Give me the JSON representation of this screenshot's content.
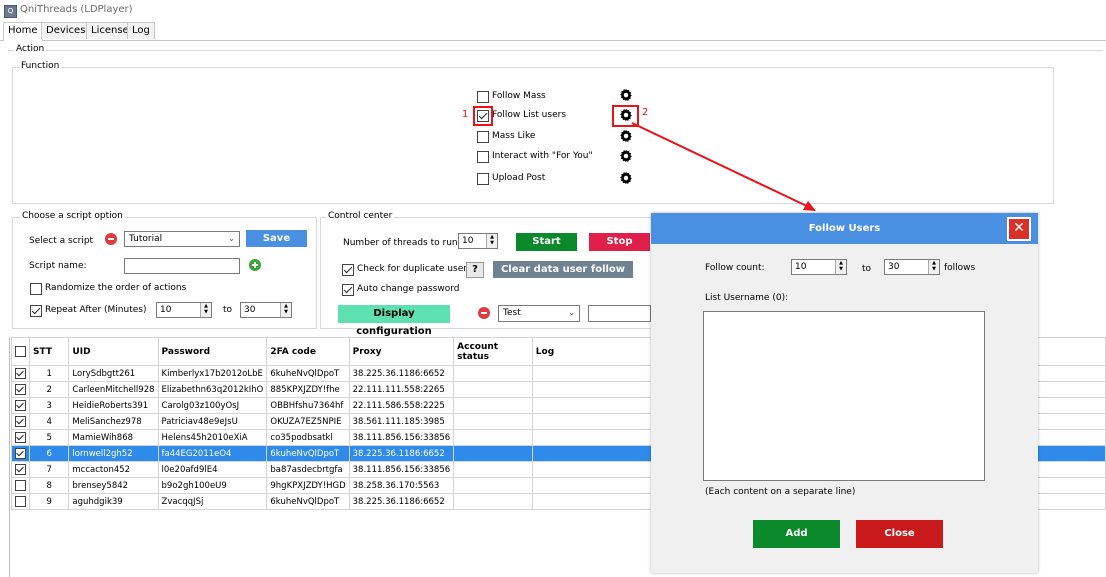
{
  "window": {
    "title": "QniThreads (LDPlayer)",
    "icon": "app-icon"
  },
  "tabs": [
    {
      "label": "Home"
    },
    {
      "label": "Devices"
    },
    {
      "label": "License"
    },
    {
      "label": "Log"
    }
  ],
  "action_group": {
    "label": "Action"
  },
  "function_group": {
    "label": "Function",
    "items": [
      {
        "label": "Follow Mass",
        "checked": false
      },
      {
        "label": "Follow List users",
        "checked": true
      },
      {
        "label": "Mass Like",
        "checked": false
      },
      {
        "label": "Interact with \"For You\"",
        "checked": false
      },
      {
        "label": "Upload Post",
        "checked": false
      }
    ],
    "annotations": {
      "one": "1",
      "two": "2"
    }
  },
  "script_group": {
    "label": "Choose a script option",
    "select_label": "Select a script",
    "select_value": "Tutorial",
    "save_label": "Save",
    "script_name_label": "Script name:",
    "script_name_value": "",
    "randomize_label": "Randomize the order of actions",
    "randomize_checked": false,
    "repeat_label": "Repeat After (Minutes)",
    "repeat_checked": true,
    "repeat_from": "10",
    "repeat_to_label": "to",
    "repeat_to": "30"
  },
  "control_center": {
    "label": "Control center",
    "threads_label": "Number of threads to run:",
    "threads_value": "10",
    "start_label": "Start",
    "stop_label": "Stop",
    "check_dup_label": "Check for duplicate users",
    "check_dup_checked": true,
    "help_label": "?",
    "clear_label": "Clear data user follow",
    "auto_change_label": "Auto change password",
    "auto_change_checked": true,
    "display_config_label": "Display configuration",
    "config_select_value": "Test",
    "config_input_value": ""
  },
  "table": {
    "headers": [
      "STT",
      "UID",
      "Password",
      "2FA code",
      "Proxy",
      "Account status",
      "Log"
    ],
    "rows": [
      {
        "checked": true,
        "stt": "1",
        "uid": "LorySdbgtt261",
        "password": "Kimberlyx17b2012oLbE",
        "twofa": "6kuheNvQlDpoT",
        "proxy": "38.225.36.1186:6652",
        "status": "",
        "log": "",
        "selected": false
      },
      {
        "checked": true,
        "stt": "2",
        "uid": "CarleenMitchell928",
        "password": "Elizabethn63q2012kIhO",
        "twofa": "885KPXJZDY!fhe",
        "proxy": "22.111.111.558:2265",
        "status": "",
        "log": "",
        "selected": false
      },
      {
        "checked": true,
        "stt": "3",
        "uid": "HeidieRoberts391",
        "password": "Carolg03z100yOsJ",
        "twofa": "OBBHfshu7364hf",
        "proxy": "22.111.586.558:2225",
        "status": "",
        "log": "",
        "selected": false
      },
      {
        "checked": true,
        "stt": "4",
        "uid": "MeliSanchez978",
        "password": "Patriciav48e9eJsU",
        "twofa": "OKUZA7EZ5NPIE",
        "proxy": "38.561.111.185:3985",
        "status": "",
        "log": "",
        "selected": false
      },
      {
        "checked": true,
        "stt": "5",
        "uid": "MamieWih868",
        "password": "Helens45h2010eXiA",
        "twofa": "co35podbsatkl",
        "proxy": "38.111.856.156:33856",
        "status": "",
        "log": "",
        "selected": false
      },
      {
        "checked": true,
        "stt": "6",
        "uid": "lornwell2gh52",
        "password": "fa44EG2011eO4",
        "twofa": "6kuheNvQlDpoT",
        "proxy": "38.225.36.1186:6652",
        "status": "",
        "log": "",
        "selected": true
      },
      {
        "checked": true,
        "stt": "7",
        "uid": "mccacton452",
        "password": "l0e20afd9lE4",
        "twofa": "ba87asdecbrtgfa",
        "proxy": "38.111.856.156:33856",
        "status": "",
        "log": "",
        "selected": false
      },
      {
        "checked": false,
        "stt": "8",
        "uid": "brensey5842",
        "password": "b9o2gh100eU9",
        "twofa": "9hgKPXJZDY!HGD",
        "proxy": "38.258.36.170:5563",
        "status": "",
        "log": "",
        "selected": false
      },
      {
        "checked": false,
        "stt": "9",
        "uid": "aguhdgik39",
        "password": "ZvacqqJSj",
        "twofa": "6kuheNvQlDpoT",
        "proxy": "38.225.36.1186:6652",
        "status": "",
        "log": "",
        "selected": false
      }
    ]
  },
  "follow_dialog": {
    "title": "Follow Users",
    "close_icon": "close-icon",
    "follow_count_label": "Follow count:",
    "follow_from": "10",
    "to_label": "to",
    "follow_to": "30",
    "follows_label": "follows",
    "list_label": "List Username (0):",
    "list_value": "",
    "hint": "(Each content on a separate line)",
    "add_label": "Add",
    "close_label": "Close"
  },
  "colors": {
    "annotation_red": "#e8141a",
    "save_blue": "#4a90e2",
    "start_green": "#0a8a2a",
    "stop_red": "#e0204a",
    "clear_gray": "#6f8291",
    "config_mint": "#5fe0b0",
    "selection_blue": "#2f8be9",
    "add_green": "#0a8a2a",
    "close_red": "#c81a1a"
  }
}
